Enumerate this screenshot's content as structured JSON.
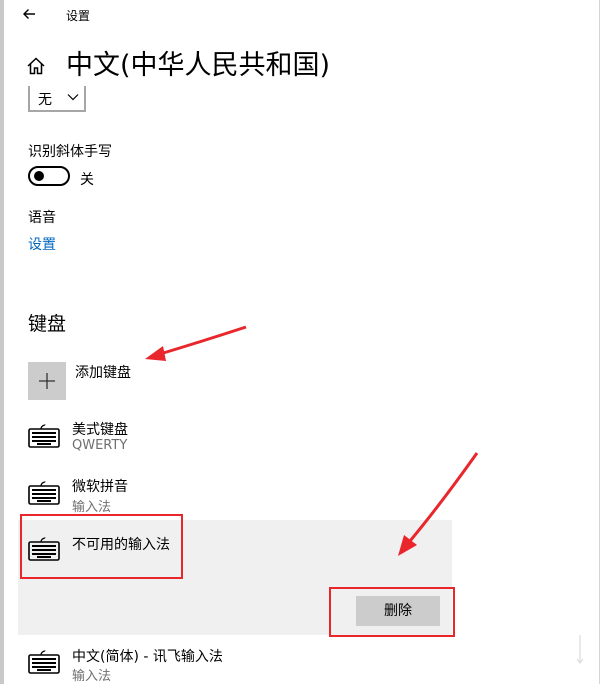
{
  "window": {
    "title": "设置"
  },
  "page": {
    "title": "中文(中华人民共和国)"
  },
  "dropdown": {
    "value": "无"
  },
  "handwriting": {
    "label": "识别斜体手写",
    "toggle_state": "关"
  },
  "speech": {
    "heading": "语音",
    "link": "设置"
  },
  "keyboards": {
    "section_title": "键盘",
    "add_label": "添加键盘",
    "items": [
      {
        "name": "美式键盘",
        "sub": "QWERTY"
      },
      {
        "name": "微软拼音",
        "sub": "输入法"
      },
      {
        "name": "不可用的输入法",
        "sub": ""
      },
      {
        "name": "中文(简体) - 讯飞输入法",
        "sub": "输入法"
      }
    ],
    "delete_label": "删除"
  },
  "colors": {
    "link": "#0067c0",
    "annotation": "#e8262b",
    "selected_bg": "#f0f0f0"
  }
}
